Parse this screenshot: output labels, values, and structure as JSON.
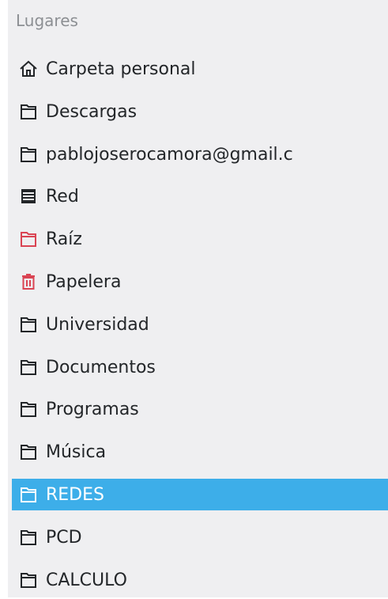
{
  "places": {
    "header": "Lugares",
    "items": [
      {
        "label": "Carpeta personal",
        "icon": "home-icon",
        "color": "#232629",
        "selected": false
      },
      {
        "label": "Descargas",
        "icon": "folder-icon",
        "color": "#232629",
        "selected": false
      },
      {
        "label": "pablojoserocamora@gmail.c",
        "icon": "folder-icon",
        "color": "#232629",
        "selected": false
      },
      {
        "label": "Red",
        "icon": "network-icon",
        "color": "#232629",
        "selected": false
      },
      {
        "label": "Raíz",
        "icon": "folder-icon",
        "color": "#da4453",
        "selected": false
      },
      {
        "label": "Papelera",
        "icon": "trash-icon",
        "color": "#da4453",
        "selected": false
      },
      {
        "label": "Universidad",
        "icon": "folder-icon",
        "color": "#232629",
        "selected": false
      },
      {
        "label": "Documentos",
        "icon": "folder-icon",
        "color": "#232629",
        "selected": false
      },
      {
        "label": "Programas",
        "icon": "folder-icon",
        "color": "#232629",
        "selected": false
      },
      {
        "label": "Música",
        "icon": "folder-icon",
        "color": "#232629",
        "selected": false
      },
      {
        "label": "REDES",
        "icon": "folder-icon",
        "color": "#ffffff",
        "selected": true
      },
      {
        "label": "PCD",
        "icon": "folder-icon",
        "color": "#232629",
        "selected": false
      },
      {
        "label": "CALCULO",
        "icon": "folder-icon",
        "color": "#232629",
        "selected": false
      }
    ]
  },
  "colors": {
    "panel_background": "#efeff1",
    "selection": "#3daee9",
    "header_text": "#8c8f93",
    "text": "#232629",
    "danger": "#da4453"
  }
}
